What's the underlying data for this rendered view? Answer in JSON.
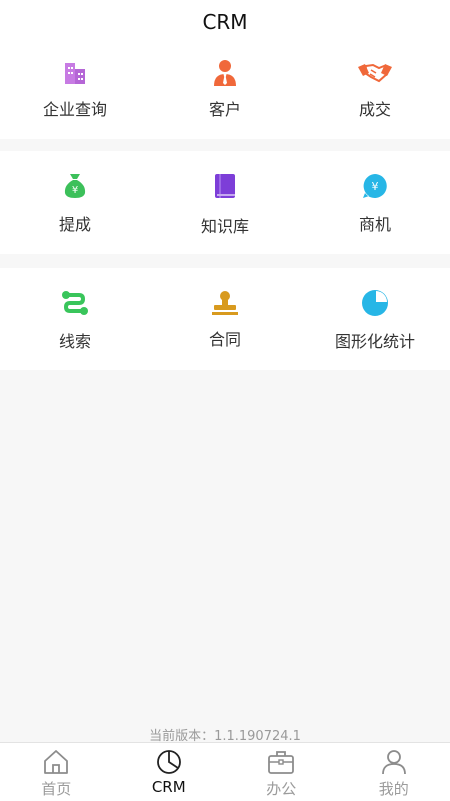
{
  "header": {
    "title": "CRM"
  },
  "grid": {
    "rows": [
      [
        {
          "label": "企业查询",
          "icon": "building-icon",
          "color": "#c77be3"
        },
        {
          "label": "客户",
          "icon": "customer-icon",
          "color": "#f0683a"
        },
        {
          "label": "成交",
          "icon": "handshake-icon",
          "color": "#f0683a"
        }
      ],
      [
        {
          "label": "提成",
          "icon": "money-bag-icon",
          "color": "#3cc05a"
        },
        {
          "label": "知识库",
          "icon": "book-icon",
          "color": "#7d3ed8"
        },
        {
          "label": "商机",
          "icon": "yen-bubble-icon",
          "color": "#27b6e6"
        }
      ],
      [
        {
          "label": "线索",
          "icon": "path-icon",
          "color": "#39c55b"
        },
        {
          "label": "合同",
          "icon": "stamp-icon",
          "color": "#d89a1e"
        },
        {
          "label": "图形化统计",
          "icon": "pie-chart-icon",
          "color": "#27b6e6"
        }
      ]
    ]
  },
  "footer": {
    "version": "当前版本：1.1.190724.1"
  },
  "tabbar": {
    "items": [
      {
        "label": "首页",
        "icon": "home-icon",
        "active": false
      },
      {
        "label": "CRM",
        "icon": "pie-outline-icon",
        "active": true
      },
      {
        "label": "办公",
        "icon": "briefcase-icon",
        "active": false
      },
      {
        "label": "我的",
        "icon": "user-icon",
        "active": false
      }
    ]
  }
}
